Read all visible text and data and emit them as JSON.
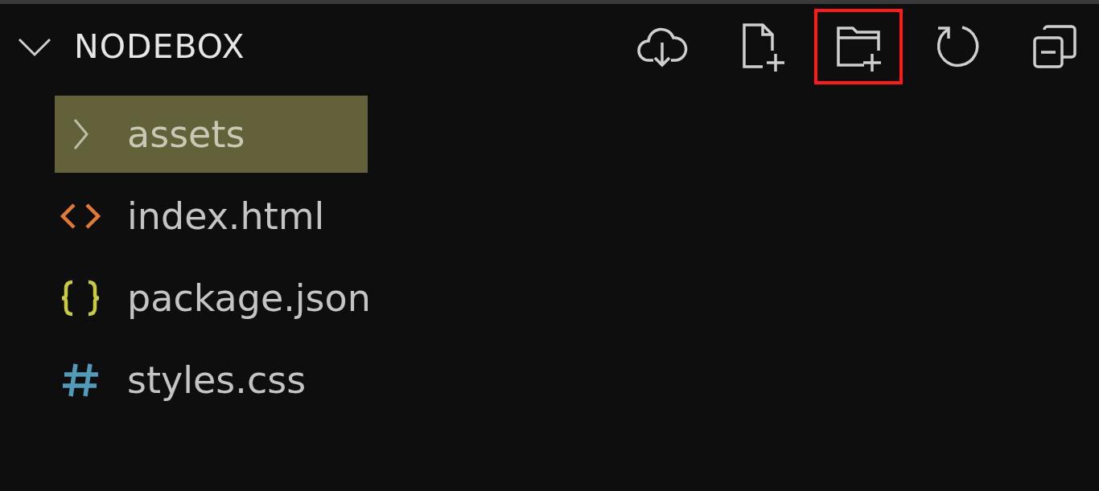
{
  "explorer": {
    "title": "NODEBOX",
    "expanded": true,
    "actions": [
      {
        "kind": "cloud-download",
        "highlighted": false
      },
      {
        "kind": "new-file",
        "highlighted": false
      },
      {
        "kind": "new-folder",
        "highlighted": true
      },
      {
        "kind": "refresh",
        "highlighted": false
      },
      {
        "kind": "collapse",
        "highlighted": false
      }
    ],
    "items": [
      {
        "kind": "folder",
        "name": "assets",
        "selected": true,
        "expanded": false
      },
      {
        "kind": "html",
        "name": "index.html",
        "selected": false
      },
      {
        "kind": "json",
        "name": "package.json",
        "selected": false
      },
      {
        "kind": "css",
        "name": "styles.css",
        "selected": false
      }
    ]
  }
}
